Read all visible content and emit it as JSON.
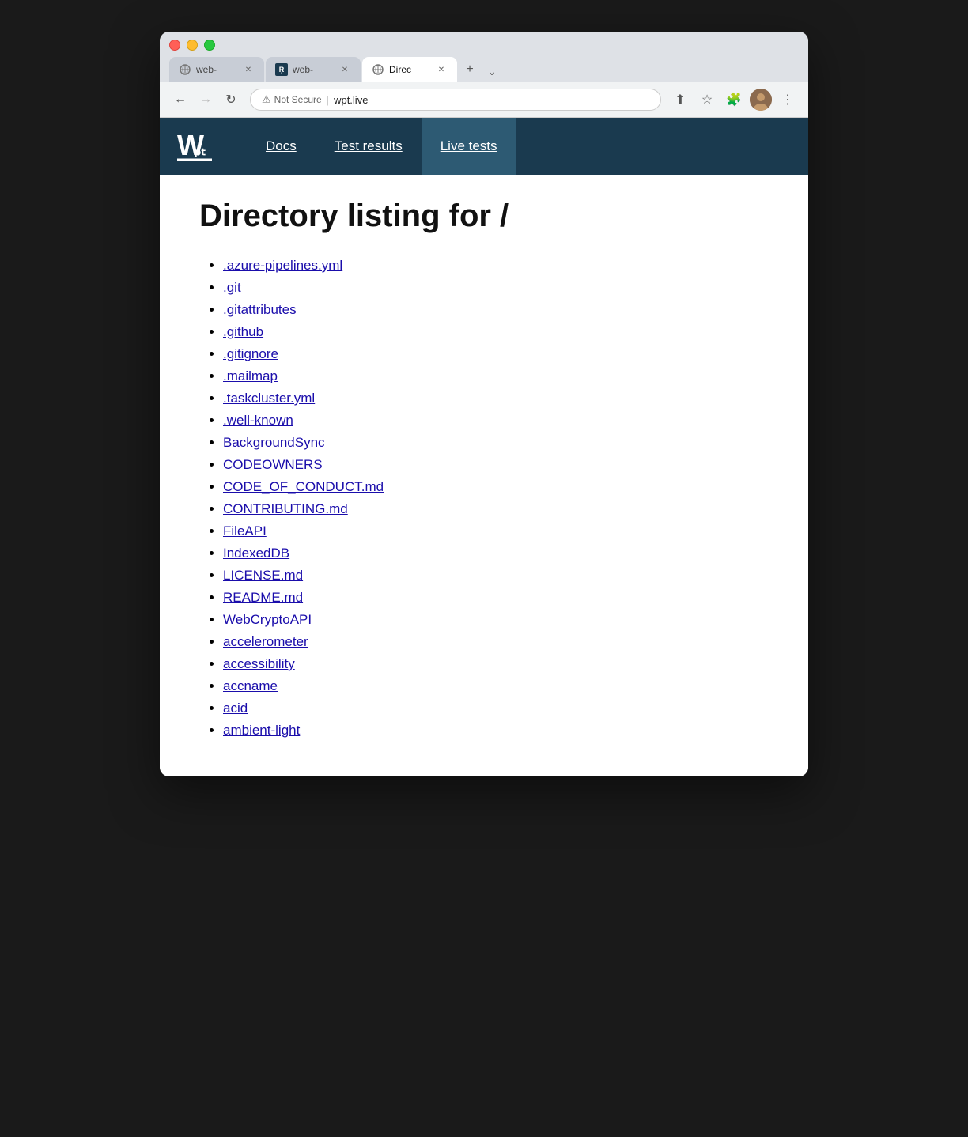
{
  "browser": {
    "tabs": [
      {
        "id": "tab1",
        "favicon_type": "globe",
        "title": "web-",
        "active": false
      },
      {
        "id": "tab2",
        "favicon_type": "wpt",
        "title": "web-",
        "active": false
      },
      {
        "id": "tab3",
        "favicon_type": "globe",
        "title": "Direc",
        "active": true
      }
    ],
    "new_tab_label": "+",
    "overflow_label": "⌄",
    "address": {
      "warning": "⚠",
      "not_secure": "Not Secure",
      "url": "wpt.live"
    },
    "nav": {
      "back": "←",
      "forward": "→",
      "reload": "↻"
    },
    "toolbar_icons": {
      "share": "⬆",
      "bookmark": "☆",
      "extensions": "🧩",
      "menu": "⋮"
    }
  },
  "site": {
    "nav": {
      "logo_alt": "WPT Logo",
      "links": [
        {
          "label": "Docs",
          "active": false
        },
        {
          "label": "Test results",
          "active": false
        },
        {
          "label": "Live tests",
          "active": true
        }
      ]
    },
    "page_title": "Directory listing for /",
    "files": [
      ".azure-pipelines.yml",
      ".git",
      ".gitattributes",
      ".github",
      ".gitignore",
      ".mailmap",
      ".taskcluster.yml",
      ".well-known",
      "BackgroundSync",
      "CODEOWNERS",
      "CODE_OF_CONDUCT.md",
      "CONTRIBUTING.md",
      "FileAPI",
      "IndexedDB",
      "LICENSE.md",
      "README.md",
      "WebCryptoAPI",
      "accelerometer",
      "accessibility",
      "accname",
      "acid",
      "ambient-light"
    ]
  }
}
